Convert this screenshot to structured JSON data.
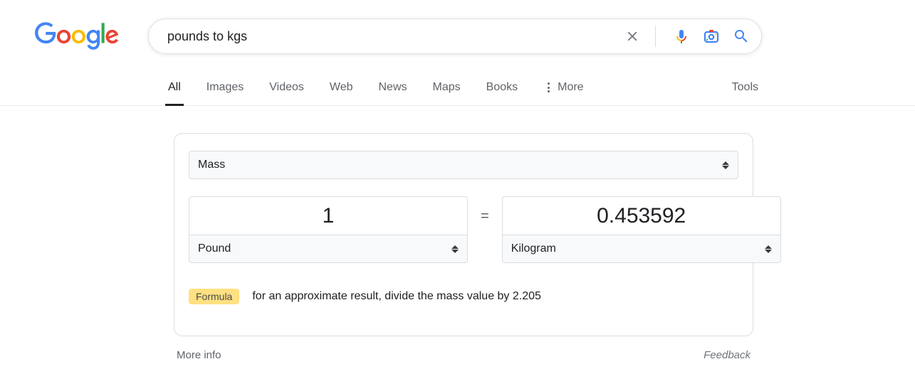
{
  "search": {
    "query": "pounds to kgs"
  },
  "tabs": {
    "all": "All",
    "images": "Images",
    "videos": "Videos",
    "web": "Web",
    "news": "News",
    "maps": "Maps",
    "books": "Books",
    "more": "More",
    "tools": "Tools"
  },
  "converter": {
    "category": "Mass",
    "equals": "=",
    "from_value": "1",
    "from_unit": "Pound",
    "to_value": "0.453592",
    "to_unit": "Kilogram",
    "formula_label": "Formula",
    "formula_text": "for an approximate result, divide the mass value by 2.205"
  },
  "footer": {
    "more_info": "More info",
    "feedback": "Feedback"
  }
}
